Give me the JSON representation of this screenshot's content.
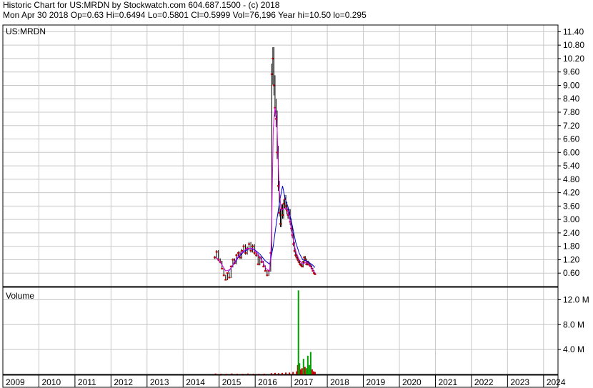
{
  "header": {
    "line1": "Historic Chart for US:MRDN by Stockwatch.com 604.687.1500 - (c) 2018",
    "line2": "Mon Apr 30 2018   Op=0.63   Hi=0.6494   Lo=0.5801   Cl=0.5999   Vol=76,196   Year hi=10.50   lo=0.295"
  },
  "chart_data": [
    {
      "type": "line",
      "panel_label": "US:MRDN",
      "ylim": [
        0,
        11.7
      ],
      "yticks": [
        "11.40",
        "10.80",
        "10.20",
        "9.60",
        "9.00",
        "8.40",
        "7.80",
        "7.20",
        "6.60",
        "6.00",
        "5.40",
        "4.80",
        "4.20",
        "3.60",
        "3.00",
        "2.40",
        "1.80",
        "1.20",
        "0.60"
      ],
      "x_range": [
        2009,
        2024.4
      ],
      "xticks": [
        "2009",
        "2010",
        "2011",
        "2012",
        "2013",
        "2014",
        "2015",
        "2016",
        "2017",
        "2018",
        "2019",
        "2020",
        "2021",
        "2022",
        "2023",
        "2024"
      ],
      "grid": true,
      "price": [
        [
          2014.88,
          1.3
        ],
        [
          2014.93,
          1.55
        ],
        [
          2014.98,
          1.2
        ],
        [
          2015.03,
          1.1
        ],
        [
          2015.08,
          0.8
        ],
        [
          2015.13,
          0.5
        ],
        [
          2015.18,
          0.3
        ],
        [
          2015.23,
          0.6
        ],
        [
          2015.28,
          0.4
        ],
        [
          2015.33,
          0.9
        ],
        [
          2015.38,
          1.2
        ],
        [
          2015.43,
          1.05
        ],
        [
          2015.48,
          1.4
        ],
        [
          2015.53,
          1.5
        ],
        [
          2015.58,
          1.3
        ],
        [
          2015.63,
          1.6
        ],
        [
          2015.68,
          1.8
        ],
        [
          2015.73,
          1.5
        ],
        [
          2015.78,
          1.7
        ],
        [
          2015.83,
          1.9
        ],
        [
          2015.88,
          1.6
        ],
        [
          2015.93,
          1.8
        ],
        [
          2015.98,
          1.5
        ],
        [
          2016.03,
          1.4
        ],
        [
          2016.08,
          1.0
        ],
        [
          2016.13,
          1.3
        ],
        [
          2016.18,
          1.1
        ],
        [
          2016.23,
          0.9
        ],
        [
          2016.28,
          0.7
        ],
        [
          2016.33,
          0.5
        ],
        [
          2016.38,
          0.7
        ],
        [
          2016.43,
          1.5
        ],
        [
          2016.46,
          9.5
        ],
        [
          2016.49,
          10.2
        ],
        [
          2016.52,
          9.0
        ],
        [
          2016.55,
          8.0
        ],
        [
          2016.58,
          7.5
        ],
        [
          2016.61,
          6.0
        ],
        [
          2016.64,
          4.5
        ],
        [
          2016.67,
          3.3
        ],
        [
          2016.7,
          2.8
        ],
        [
          2016.73,
          3.5
        ],
        [
          2016.76,
          3.2
        ],
        [
          2016.79,
          3.7
        ],
        [
          2016.82,
          3.9
        ],
        [
          2016.85,
          3.6
        ],
        [
          2016.88,
          3.4
        ],
        [
          2016.91,
          3.2
        ],
        [
          2016.94,
          3.3
        ],
        [
          2016.97,
          2.9
        ],
        [
          2017.0,
          2.6
        ],
        [
          2017.03,
          2.3
        ],
        [
          2017.06,
          1.9
        ],
        [
          2017.09,
          1.6
        ],
        [
          2017.12,
          1.4
        ],
        [
          2017.15,
          1.3
        ],
        [
          2017.18,
          1.2
        ],
        [
          2017.21,
          1.1
        ],
        [
          2017.24,
          1.0
        ],
        [
          2017.27,
          0.95
        ],
        [
          2017.3,
          0.9
        ],
        [
          2017.33,
          1.1
        ],
        [
          2017.36,
          1.3
        ],
        [
          2017.39,
          1.2
        ],
        [
          2017.42,
          1.0
        ],
        [
          2017.45,
          1.1
        ],
        [
          2017.48,
          1.0
        ],
        [
          2017.51,
          0.95
        ],
        [
          2017.54,
          0.9
        ],
        [
          2017.57,
          0.8
        ],
        [
          2017.6,
          0.7
        ],
        [
          2017.63,
          0.6
        ],
        [
          2017.66,
          0.55
        ]
      ],
      "moving_average_fast": [
        [
          2014.93,
          1.3
        ],
        [
          2015.05,
          1.05
        ],
        [
          2015.18,
          0.7
        ],
        [
          2015.3,
          0.75
        ],
        [
          2015.43,
          1.1
        ],
        [
          2015.55,
          1.4
        ],
        [
          2015.68,
          1.6
        ],
        [
          2015.8,
          1.7
        ],
        [
          2015.93,
          1.7
        ],
        [
          2016.05,
          1.5
        ],
        [
          2016.18,
          1.2
        ],
        [
          2016.3,
          0.8
        ],
        [
          2016.4,
          0.7
        ],
        [
          2016.45,
          2.0
        ],
        [
          2016.5,
          7.0
        ],
        [
          2016.55,
          8.0
        ],
        [
          2016.6,
          7.5
        ],
        [
          2016.66,
          4.5
        ],
        [
          2016.72,
          3.4
        ],
        [
          2016.8,
          3.5
        ],
        [
          2016.88,
          3.5
        ],
        [
          2016.96,
          3.0
        ],
        [
          2017.04,
          2.2
        ],
        [
          2017.12,
          1.6
        ],
        [
          2017.22,
          1.2
        ],
        [
          2017.32,
          1.0
        ],
        [
          2017.42,
          1.1
        ],
        [
          2017.52,
          0.95
        ],
        [
          2017.6,
          0.75
        ],
        [
          2017.66,
          0.6
        ]
      ],
      "moving_average_slow": [
        [
          2015.25,
          0.65
        ],
        [
          2015.38,
          0.95
        ],
        [
          2015.53,
          1.3
        ],
        [
          2015.68,
          1.55
        ],
        [
          2015.83,
          1.7
        ],
        [
          2015.98,
          1.65
        ],
        [
          2016.13,
          1.45
        ],
        [
          2016.28,
          1.15
        ],
        [
          2016.4,
          1.0
        ],
        [
          2016.5,
          1.8
        ],
        [
          2016.6,
          3.0
        ],
        [
          2016.7,
          4.0
        ],
        [
          2016.76,
          4.5
        ],
        [
          2016.82,
          4.0
        ],
        [
          2016.92,
          3.5
        ],
        [
          2017.02,
          2.8
        ],
        [
          2017.12,
          2.0
        ],
        [
          2017.22,
          1.5
        ],
        [
          2017.32,
          1.2
        ],
        [
          2017.42,
          1.15
        ],
        [
          2017.52,
          1.05
        ],
        [
          2017.6,
          0.95
        ],
        [
          2017.66,
          0.85
        ]
      ]
    },
    {
      "type": "bar",
      "panel_label": "Volume",
      "ylim": [
        0,
        14000000
      ],
      "yticks": [
        "12.0 M",
        "8.0 M",
        "4.0 M"
      ],
      "volume_bars": [
        [
          2014.9,
          0.15,
          "#c00000"
        ],
        [
          2015.05,
          0.12,
          "#c00000"
        ],
        [
          2015.2,
          0.1,
          "#c00000"
        ],
        [
          2015.35,
          0.15,
          "#c00000"
        ],
        [
          2015.5,
          0.12,
          "#c00000"
        ],
        [
          2015.65,
          0.1,
          "#c00000"
        ],
        [
          2015.8,
          0.15,
          "#c00000"
        ],
        [
          2015.95,
          0.12,
          "#c00000"
        ],
        [
          2016.1,
          0.1,
          "#c00000"
        ],
        [
          2016.25,
          0.12,
          "#c00000"
        ],
        [
          2016.45,
          0.2,
          "#c00000"
        ],
        [
          2016.55,
          0.25,
          "#c00000"
        ],
        [
          2016.65,
          0.2,
          "#c00000"
        ],
        [
          2016.75,
          0.25,
          "#c00000"
        ],
        [
          2016.85,
          0.3,
          "#c00000"
        ],
        [
          2016.95,
          0.3,
          "#c00000"
        ],
        [
          2017.05,
          0.4,
          "#c00000"
        ],
        [
          2017.15,
          0.5,
          "#c00000"
        ],
        [
          2017.18,
          1.5,
          "#c00000"
        ],
        [
          2017.2,
          13.5,
          "#00a000"
        ],
        [
          2017.23,
          1.8,
          "#00a000"
        ],
        [
          2017.26,
          0.8,
          "#c00000"
        ],
        [
          2017.3,
          1.0,
          "#c00000"
        ],
        [
          2017.34,
          2.5,
          "#00a000"
        ],
        [
          2017.38,
          1.2,
          "#c00000"
        ],
        [
          2017.42,
          1.0,
          "#00a000"
        ],
        [
          2017.46,
          3.0,
          "#00a000"
        ],
        [
          2017.5,
          1.5,
          "#00a000"
        ],
        [
          2017.54,
          3.6,
          "#00a000"
        ],
        [
          2017.58,
          0.8,
          "#c00000"
        ],
        [
          2017.62,
          0.5,
          "#c00000"
        ],
        [
          2017.66,
          0.4,
          "#c00000"
        ]
      ]
    }
  ]
}
